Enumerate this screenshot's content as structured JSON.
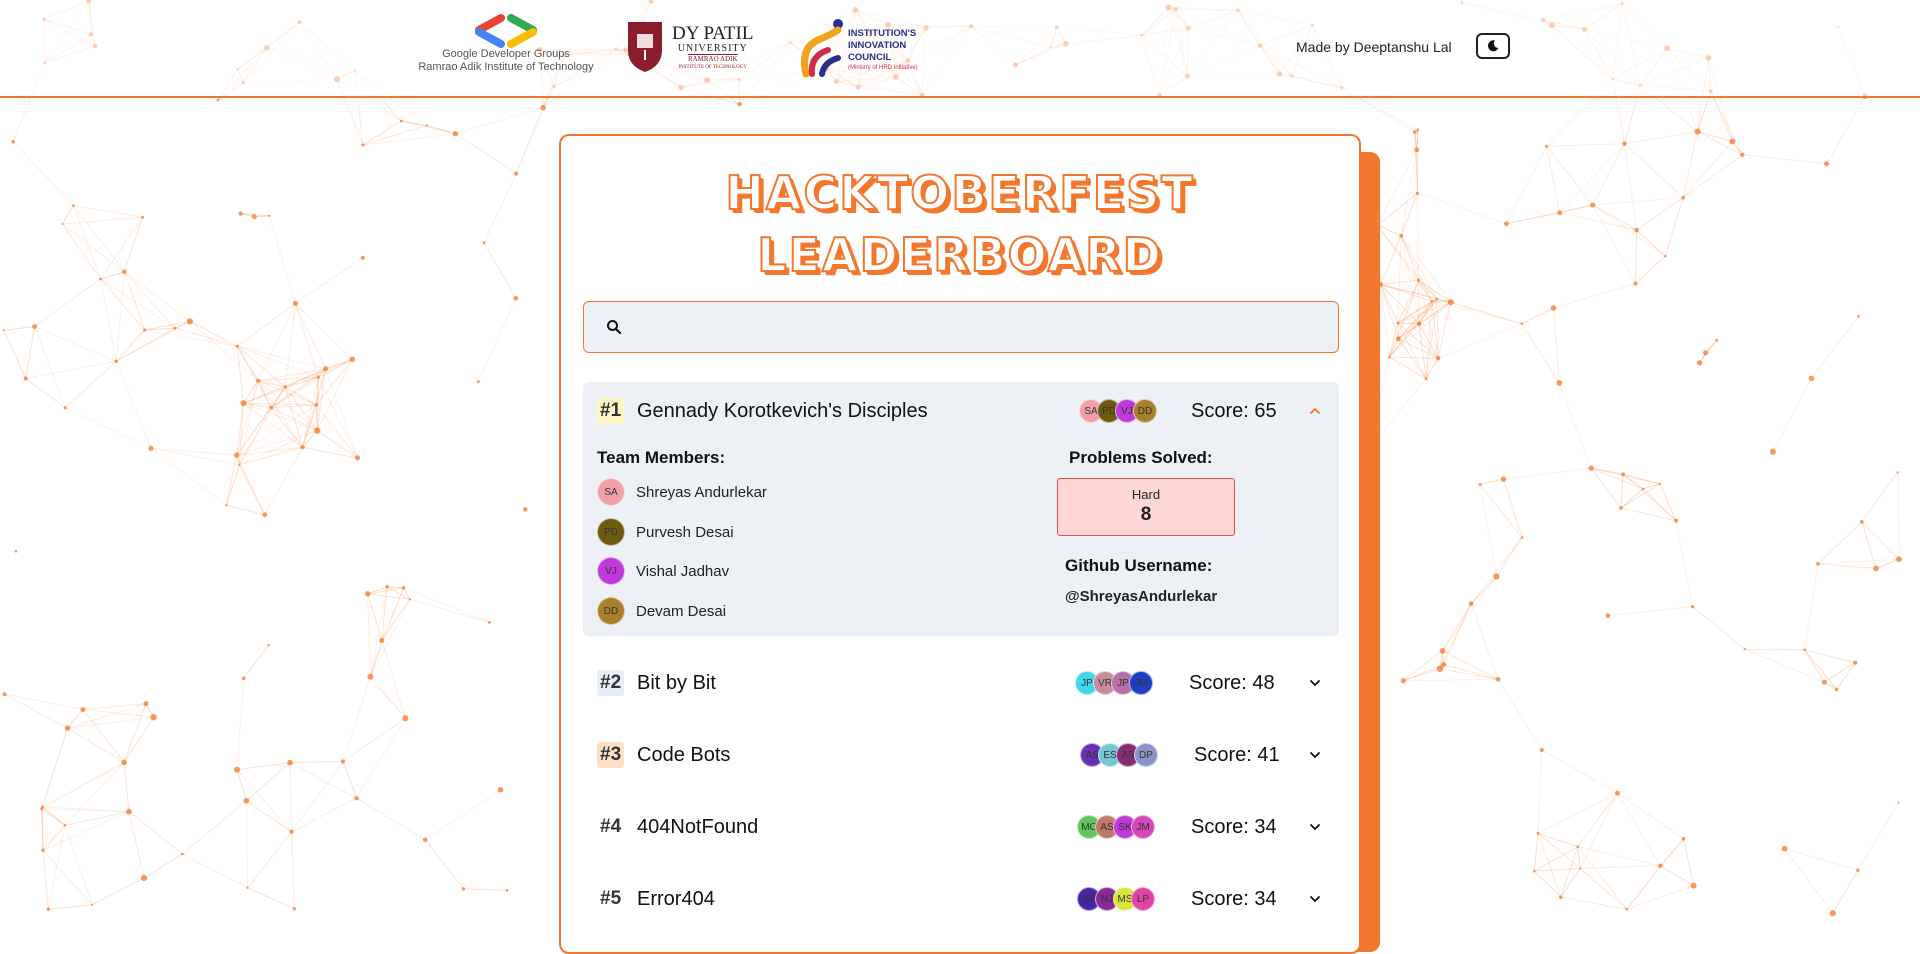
{
  "header": {
    "logos": {
      "gdg_line1": "Google Developer Groups",
      "gdg_line2": "Ramrao Adik Institute of Technology",
      "dyp_title": "DY PATIL",
      "dyp_sub": "UNIVERSITY",
      "dyp_sub2": "RAMRAO ADIK",
      "dyp_sub3": "INSTITUTE OF TECHNOLOGY",
      "iic_line1": "INSTITUTION'S",
      "iic_line2": "INNOVATION",
      "iic_line3": "COUNCIL",
      "iic_small": "(Ministry of HRD Initiative)"
    },
    "made_by": "Made by Deeptanshu Lal",
    "theme_icon": "moon-icon"
  },
  "title": {
    "line1": "HACKTOBERFEST",
    "line2": "LEADERBOARD"
  },
  "search": {
    "placeholder": "",
    "icon": "search-icon"
  },
  "colors": {
    "accent": "#f3782e",
    "panel": "#edf1f5",
    "hard_bg": "#fdd6d6",
    "hard_border": "#e84a4a"
  },
  "teams": [
    {
      "rank": "#1",
      "name": "Gennady Korotkevich's Disciples",
      "score": "Score: 65",
      "rank_bg": "#fdf5c4",
      "avatars": [
        {
          "initials": "SA",
          "color": "#f1a0a8"
        },
        {
          "initials": "PD",
          "color": "#6e5a0e"
        },
        {
          "initials": "VJ",
          "color": "#c03ad9"
        },
        {
          "initials": "DD",
          "color": "#a87f2a"
        }
      ],
      "expanded": true,
      "members_title": "Team Members:",
      "members": [
        {
          "initials": "SA",
          "name": "Shreyas Andurlekar",
          "color": "#f1a0a8"
        },
        {
          "initials": "PD",
          "name": "Purvesh Desai",
          "color": "#6e5a0e"
        },
        {
          "initials": "VJ",
          "name": "Vishal Jadhav",
          "color": "#c03ad9"
        },
        {
          "initials": "DD",
          "name": "Devam Desai",
          "color": "#a87f2a"
        }
      ],
      "problems_title": "Problems Solved:",
      "hard_label": "Hard",
      "hard_value": "8",
      "github_title": "Github Username:",
      "github_user": "@ShreyasAndurlekar"
    },
    {
      "rank": "#2",
      "name": "Bit by Bit",
      "score": "Score: 48",
      "rank_bg": "#e7eef8",
      "avatars": [
        {
          "initials": "JP",
          "color": "#3fd6ee"
        },
        {
          "initials": "VR",
          "color": "#c98c9c"
        },
        {
          "initials": "JP",
          "color": "#b96fa8"
        },
        {
          "initials": "JM",
          "color": "#1e3fc4"
        }
      ]
    },
    {
      "rank": "#3",
      "name": "Code Bots",
      "score": "Score: 41",
      "rank_bg": "#fde0c4",
      "avatars": [
        {
          "initials": "AS",
          "color": "#6b2fb0"
        },
        {
          "initials": "ES",
          "color": "#73c7d6"
        },
        {
          "initials": "AS",
          "color": "#8a2a72"
        },
        {
          "initials": "DP",
          "color": "#8a94c9"
        }
      ]
    },
    {
      "rank": "#4",
      "name": "404NotFound",
      "score": "Score: 34",
      "rank_bg": "transparent",
      "avatars": [
        {
          "initials": "MC",
          "color": "#5fc85a"
        },
        {
          "initials": "AS",
          "color": "#c07a6a"
        },
        {
          "initials": "SK",
          "color": "#c03ad9"
        },
        {
          "initials": "JM",
          "color": "#d648b8"
        }
      ]
    },
    {
      "rank": "#5",
      "name": "Error404",
      "score": "Score: 34",
      "rank_bg": "transparent",
      "avatars": [
        {
          "initials": "SP",
          "color": "#4a24a8"
        },
        {
          "initials": "NJ",
          "color": "#8a2a98"
        },
        {
          "initials": "MS",
          "color": "#d8e63a"
        },
        {
          "initials": "LP",
          "color": "#e044a8"
        }
      ]
    }
  ]
}
